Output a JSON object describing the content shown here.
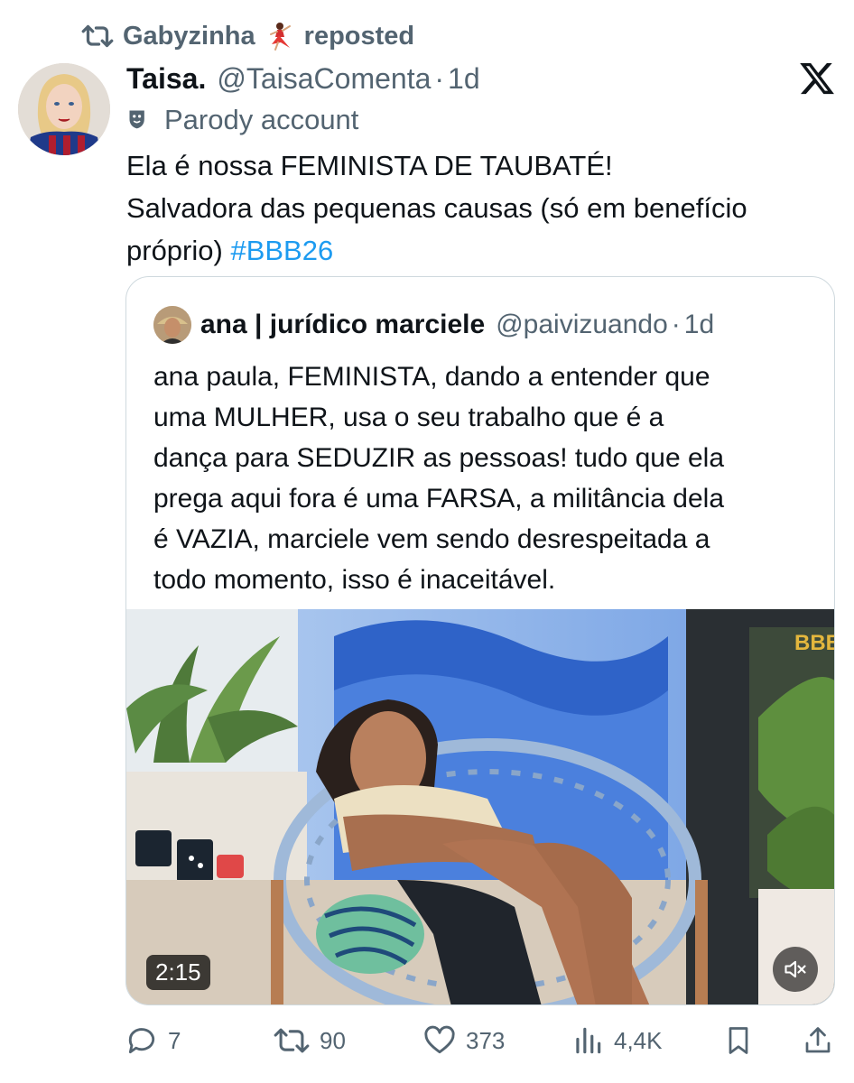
{
  "repost": {
    "user": "Gabyzinha",
    "label": "reposted",
    "icon": "repost-icon"
  },
  "tweet": {
    "author_name": "Taisa.",
    "handle": "@TaisaComenta",
    "separator": "·",
    "time": "1d",
    "parody_label": "Parody account",
    "text_lines": [
      "Ela é nossa FEMINISTA DE TAUBATÉ!",
      "Salvadora das pequenas causas (só em benefício",
      "próprio)"
    ],
    "hashtag": "#BBB26"
  },
  "quote": {
    "author_name": "ana | jurídico marciele",
    "handle": "@paivizuando",
    "separator": "·",
    "time": "1d",
    "text_lines": [
      "ana paula, FEMINISTA, dando a entender que",
      "uma MULHER, usa o seu trabalho que é a",
      "dança para SEDUZIR as pessoas! tudo que ela",
      "prega aqui fora é uma FARSA, a militância dela",
      "é VAZIA, marciele vem sendo desrespeitada a",
      "todo momento, isso é inaceitável."
    ],
    "video": {
      "duration": "2:15",
      "watermark": "BBB",
      "muted": true
    }
  },
  "actions": {
    "replies": "7",
    "reposts": "90",
    "likes": "373",
    "views": "4,4K"
  },
  "colors": {
    "text": "#0f1419",
    "secondary": "#536471",
    "link": "#1d9bf0",
    "border": "#cfd9de"
  }
}
